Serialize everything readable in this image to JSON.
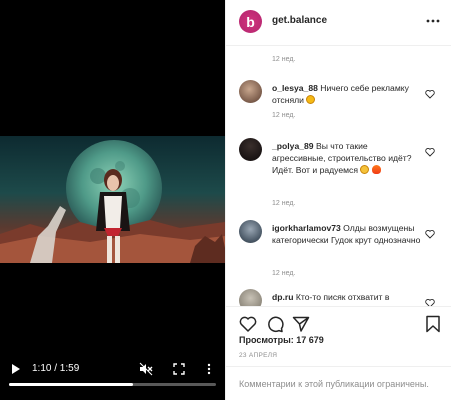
{
  "video": {
    "time_display": "1:10 / 1:59",
    "progress_fraction": 0.6,
    "play_icon": "play-icon",
    "mute_icon": "muted-speaker-icon",
    "fullscreen_icon": "fullscreen-icon",
    "more_icon": "more-vertical-icon"
  },
  "post": {
    "username": "get.balance",
    "avatar_letter": "b",
    "top_time": "12 нед.",
    "views_label": "Просмотры:",
    "views_count": "17 679",
    "date": "23 АПРЕЛЯ",
    "comments_disabled": "Комментарии к этой публикации ограничены."
  },
  "comments": [
    {
      "user": "o_lesya_88",
      "text": "Ничего себе рекламку отсняли",
      "time": "12 нед."
    },
    {
      "user": "_polya_89",
      "text": "Вы что такие агрессивные, строительство идёт? Идёт. Вот и радуемся",
      "time": "12 нед."
    },
    {
      "user": "igorkharlamov73",
      "text": "Олды возмущены категорически Гудок крут однозначно",
      "time": "12 нед."
    },
    {
      "user": "dp.ru",
      "text": "Кто-то писяк отхватит в",
      "time": ""
    }
  ],
  "colors": {
    "brand": "#d1347e",
    "text": "#262626",
    "muted": "#8e8e8e",
    "border": "#efefef"
  }
}
